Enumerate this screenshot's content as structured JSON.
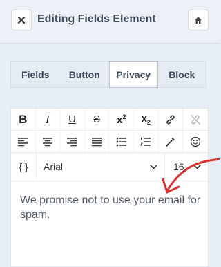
{
  "header": {
    "title": "Editing Fields Element",
    "close_icon": "close-icon",
    "home_icon": "home-icon"
  },
  "tabs": [
    {
      "label": "Fields",
      "active": false
    },
    {
      "label": "Button",
      "active": false
    },
    {
      "label": "Privacy",
      "active": true
    },
    {
      "label": "Block",
      "active": false
    }
  ],
  "toolbar": {
    "row1": [
      "bold-icon",
      "italic-icon",
      "underline-icon",
      "strikethrough-icon",
      "superscript-icon",
      "subscript-icon",
      "link-icon",
      "unlink-icon"
    ],
    "row2": [
      "align-left-icon",
      "align-center-icon",
      "align-right-icon",
      "align-justify-icon",
      "bullet-list-icon",
      "numbered-list-icon",
      "color-picker-icon",
      "emoji-icon"
    ]
  },
  "font": {
    "code_label": "{ }",
    "family": "Arial",
    "size": "16"
  },
  "editor": {
    "content": "We promise not to use your email for spam."
  },
  "colors": {
    "accent_arrow": "#d9332f"
  }
}
